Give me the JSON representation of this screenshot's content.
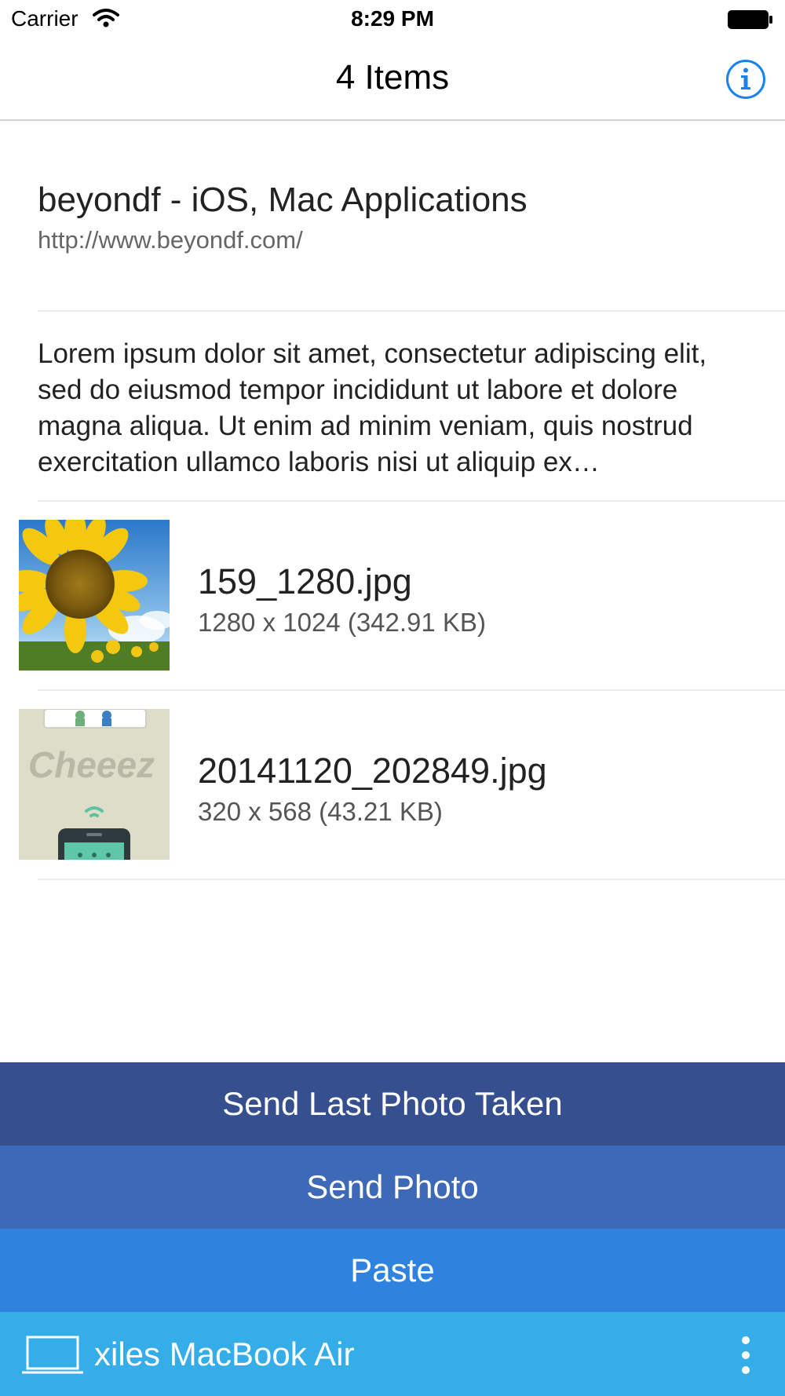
{
  "status_bar": {
    "carrier": "Carrier",
    "time": "8:29 PM"
  },
  "nav": {
    "title": "4 Items",
    "info_icon": "info-icon"
  },
  "items": {
    "link": {
      "title": "beyondf - iOS, Mac Applications",
      "url": "http://www.beyondf.com/"
    },
    "text": {
      "body": "Lorem ipsum dolor sit amet, consectetur adipiscing elit, sed do eiusmod tempor incididunt ut labore et dolore magna aliqua. Ut enim ad minim veniam, quis nostrud exercitation ullamco laboris nisi ut aliquip ex…"
    },
    "image1": {
      "name": "159_1280.jpg",
      "info": "1280 x 1024 (342.91 KB)"
    },
    "image2": {
      "name": "20141120_202849.jpg",
      "info": "320 x 568 (43.21 KB)",
      "thumb_text": "Cheeez"
    }
  },
  "actions": {
    "send_last_photo": "Send Last Photo Taken",
    "send_photo": "Send Photo",
    "paste": "Paste"
  },
  "device": {
    "name": "xiles MacBook Air",
    "icon": "laptop-icon",
    "menu_icon": "more-vertical-icon"
  },
  "colors": {
    "accent": "#1a82f0",
    "button_dark": "#354f8f",
    "button_mid": "#3d69b6",
    "button_light": "#2f82dd",
    "device_bar": "#35ade8"
  }
}
